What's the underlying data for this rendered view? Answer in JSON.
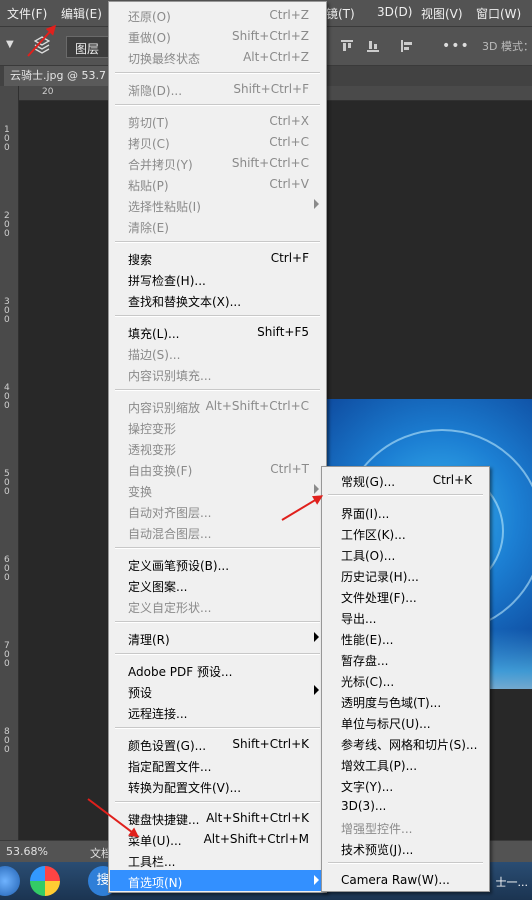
{
  "menubar": {
    "items": [
      "文件(F)",
      "编辑(E)",
      "滤镜(T)",
      "3D(D)",
      "视图(V)",
      "窗口(W)"
    ]
  },
  "options": {
    "layers_label": "图层",
    "mode_label": "3D 模式："
  },
  "document": {
    "tab_title": "云骑士.jpg @ 53.7"
  },
  "rulers": {
    "h_ticks": [
      "20"
    ],
    "v_ticks": [
      "100",
      "200",
      "300",
      "400",
      "500",
      "600",
      "700",
      "800"
    ]
  },
  "status": {
    "zoom": "53.68%",
    "doc_label": "文档"
  },
  "taskbar": {
    "search_glyph": "搜",
    "window_label": "士一..."
  },
  "edit_menu": {
    "items": [
      {
        "label": "还原(O)",
        "shortcut": "Ctrl+Z",
        "disabled": true
      },
      {
        "label": "重做(O)",
        "shortcut": "Shift+Ctrl+Z",
        "disabled": true
      },
      {
        "label": "切换最终状态",
        "shortcut": "Alt+Ctrl+Z",
        "disabled": true
      },
      {
        "label": "渐隐(D)...",
        "shortcut": "Shift+Ctrl+F",
        "disabled": true
      },
      {
        "label": "剪切(T)",
        "shortcut": "Ctrl+X",
        "disabled": true
      },
      {
        "label": "拷贝(C)",
        "shortcut": "Ctrl+C",
        "disabled": true
      },
      {
        "label": "合并拷贝(Y)",
        "shortcut": "Shift+Ctrl+C",
        "disabled": true
      },
      {
        "label": "粘贴(P)",
        "shortcut": "Ctrl+V",
        "disabled": true
      },
      {
        "label": "选择性粘贴(I)",
        "shortcut": "",
        "disabled": true,
        "submenu": true
      },
      {
        "label": "清除(E)",
        "shortcut": "",
        "disabled": true
      },
      {
        "label": "搜索",
        "shortcut": "Ctrl+F",
        "disabled": false
      },
      {
        "label": "拼写检查(H)...",
        "shortcut": "",
        "disabled": false
      },
      {
        "label": "查找和替换文本(X)...",
        "shortcut": "",
        "disabled": false
      },
      {
        "label": "填充(L)...",
        "shortcut": "Shift+F5",
        "disabled": false
      },
      {
        "label": "描边(S)...",
        "shortcut": "",
        "disabled": true
      },
      {
        "label": "内容识别填充...",
        "shortcut": "",
        "disabled": true
      },
      {
        "label": "内容识别缩放",
        "shortcut": "Alt+Shift+Ctrl+C",
        "disabled": true
      },
      {
        "label": "操控变形",
        "shortcut": "",
        "disabled": true
      },
      {
        "label": "透视变形",
        "shortcut": "",
        "disabled": true
      },
      {
        "label": "自由变换(F)",
        "shortcut": "Ctrl+T",
        "disabled": true
      },
      {
        "label": "变换",
        "shortcut": "",
        "disabled": true,
        "submenu": true
      },
      {
        "label": "自动对齐图层...",
        "shortcut": "",
        "disabled": true
      },
      {
        "label": "自动混合图层...",
        "shortcut": "",
        "disabled": true
      },
      {
        "label": "定义画笔预设(B)...",
        "shortcut": "",
        "disabled": false
      },
      {
        "label": "定义图案...",
        "shortcut": "",
        "disabled": false
      },
      {
        "label": "定义自定形状...",
        "shortcut": "",
        "disabled": true
      },
      {
        "label": "清理(R)",
        "shortcut": "",
        "disabled": false,
        "submenu": true
      },
      {
        "label": "Adobe PDF 预设...",
        "shortcut": "",
        "disabled": false
      },
      {
        "label": "预设",
        "shortcut": "",
        "disabled": false,
        "submenu": true
      },
      {
        "label": "远程连接...",
        "shortcut": "",
        "disabled": false
      },
      {
        "label": "颜色设置(G)...",
        "shortcut": "Shift+Ctrl+K",
        "disabled": false
      },
      {
        "label": "指定配置文件...",
        "shortcut": "",
        "disabled": false
      },
      {
        "label": "转换为配置文件(V)...",
        "shortcut": "",
        "disabled": false
      },
      {
        "label": "键盘快捷键...",
        "shortcut": "Alt+Shift+Ctrl+K",
        "disabled": false
      },
      {
        "label": "菜单(U)...",
        "shortcut": "Alt+Shift+Ctrl+M",
        "disabled": false
      },
      {
        "label": "工具栏...",
        "shortcut": "",
        "disabled": false
      },
      {
        "label": "首选项(N)",
        "shortcut": "",
        "disabled": false,
        "submenu": true,
        "highlighted": true
      }
    ]
  },
  "prefs_menu": {
    "items": [
      {
        "label": "常规(G)...",
        "shortcut": "Ctrl+K",
        "disabled": false
      },
      {
        "label": "界面(I)...",
        "shortcut": "",
        "disabled": false
      },
      {
        "label": "工作区(K)...",
        "shortcut": "",
        "disabled": false
      },
      {
        "label": "工具(O)...",
        "shortcut": "",
        "disabled": false
      },
      {
        "label": "历史记录(H)...",
        "shortcut": "",
        "disabled": false
      },
      {
        "label": "文件处理(F)...",
        "shortcut": "",
        "disabled": false
      },
      {
        "label": "导出...",
        "shortcut": "",
        "disabled": false
      },
      {
        "label": "性能(E)...",
        "shortcut": "",
        "disabled": false
      },
      {
        "label": "暂存盘...",
        "shortcut": "",
        "disabled": false
      },
      {
        "label": "光标(C)...",
        "shortcut": "",
        "disabled": false
      },
      {
        "label": "透明度与色域(T)...",
        "shortcut": "",
        "disabled": false
      },
      {
        "label": "单位与标尺(U)...",
        "shortcut": "",
        "disabled": false
      },
      {
        "label": "参考线、网格和切片(S)...",
        "shortcut": "",
        "disabled": false
      },
      {
        "label": "增效工具(P)...",
        "shortcut": "",
        "disabled": false
      },
      {
        "label": "文字(Y)...",
        "shortcut": "",
        "disabled": false
      },
      {
        "label": "3D(3)...",
        "shortcut": "",
        "disabled": false
      },
      {
        "label": "增强型控件...",
        "shortcut": "",
        "disabled": true
      },
      {
        "label": "技术预览(J)...",
        "shortcut": "",
        "disabled": false
      },
      {
        "label": "Camera Raw(W)...",
        "shortcut": "",
        "disabled": false
      }
    ]
  },
  "colors": {
    "highlight": "#3390ff",
    "annotation_arrow": "#e0201c"
  }
}
